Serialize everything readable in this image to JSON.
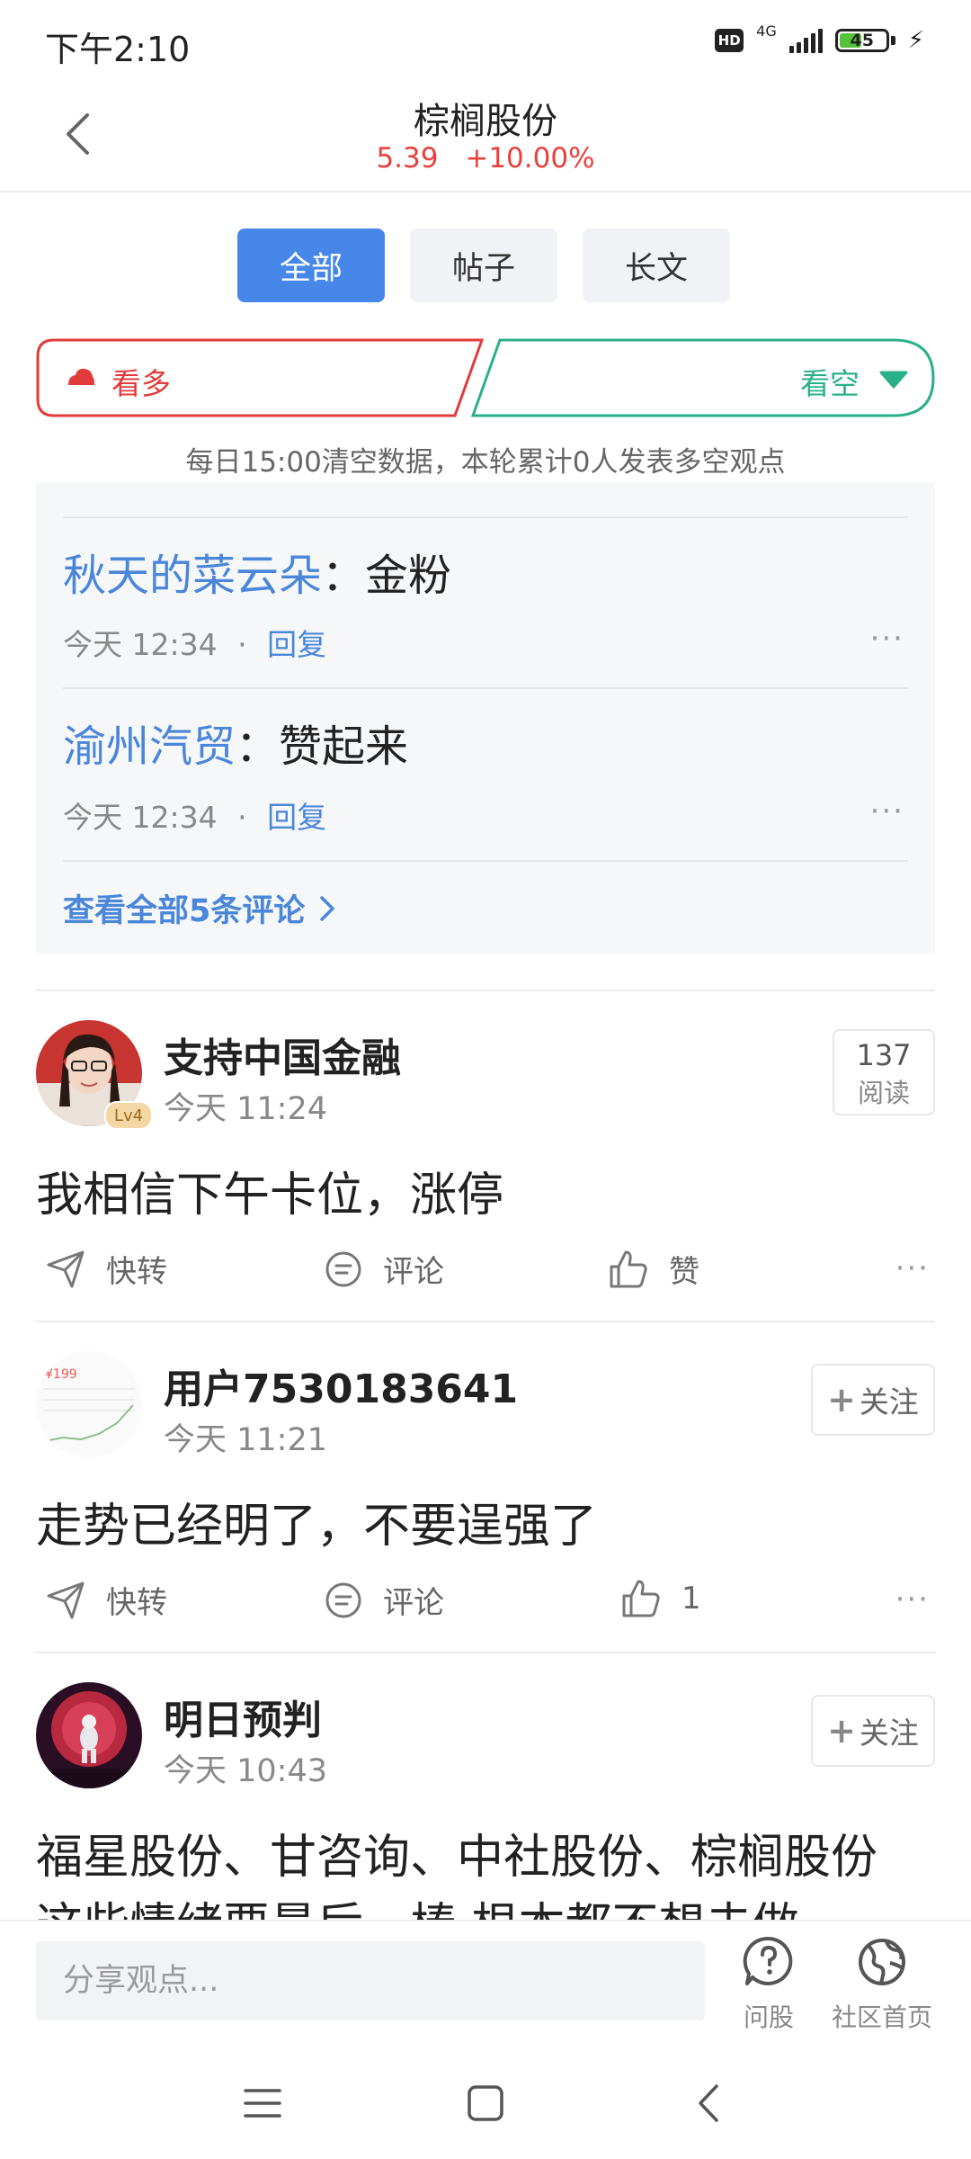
{
  "status_bar": {
    "time": "下午2:10",
    "hd": "HD",
    "network": "4G",
    "battery": "45"
  },
  "header": {
    "title": "棕榈股份",
    "price": "5.39",
    "change": "+10.00%"
  },
  "tabs": [
    {
      "label": "全部",
      "active": true
    },
    {
      "label": "帖子",
      "active": false
    },
    {
      "label": "长文",
      "active": false
    }
  ],
  "sentiment": {
    "bull_label": "看多",
    "bear_label": "看空",
    "note": "每日15:00清空数据，本轮累计0人发表多空观点"
  },
  "comments": [
    {
      "author": "秋天的菜云朵",
      "colon": "：",
      "text": "金粉",
      "time": "今天 12:34",
      "dot": "·",
      "reply": "回复",
      "more": "···"
    },
    {
      "author": "渝州汽贸",
      "colon": "：",
      "text": "赞起来",
      "time": "今天 12:34",
      "dot": "·",
      "reply": "回复",
      "more": "···"
    }
  ],
  "view_all_comments": "查看全部5条评论",
  "posts": [
    {
      "name": "支持中国金融",
      "time": "今天 11:24",
      "level": "Lv4",
      "read_count": "137",
      "read_label": "阅读",
      "content": "我相信下午卡位，涨停",
      "forward_label": "快转",
      "comment_label": "评论",
      "like_label": "赞",
      "more": "···"
    },
    {
      "name": "用户7530183641",
      "time": "今天 11:21",
      "follow_label": "关注",
      "content": "走势已经明了，不要逞强了",
      "forward_label": "快转",
      "comment_label": "评论",
      "like_label": "1",
      "more": "···",
      "avatar_text": "¥199"
    },
    {
      "name": "明日预判",
      "time": "今天 10:43",
      "follow_label": "关注",
      "content": "福星股份、甘咨询、中社股份、棕榈股份",
      "content2": "这些情绪要最后一棒 根本都不想去做"
    }
  ],
  "bottom_bar": {
    "input_placeholder": "分享观点...",
    "ask_label": "问股",
    "home_label": "社区首页"
  },
  "colors": {
    "accent": "#4787ea",
    "up_red": "#e23b3b",
    "down_green": "#2bb18a",
    "link_blue": "#4a86d9"
  }
}
